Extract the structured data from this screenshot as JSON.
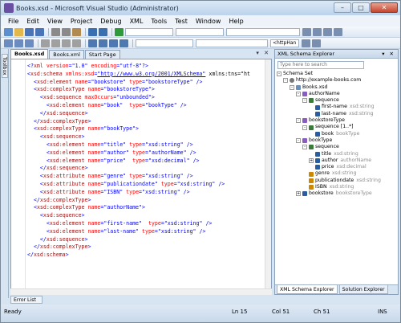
{
  "window": {
    "title": "Books.xsd - Microsoft Visual Studio (Administrator)",
    "buttons": [
      "–",
      "□",
      "✕"
    ]
  },
  "menu": [
    "File",
    "Edit",
    "View",
    "Project",
    "Debug",
    "XML",
    "Tools",
    "Test",
    "Window",
    "Help"
  ],
  "toolbar": {
    "combo_value": "<httpHan"
  },
  "left_tab": "Toolbox",
  "tabs": [
    "Books.xsd",
    "Books.xml",
    "Start Page"
  ],
  "editor": {
    "lines": [
      "<?xml version=\"1.0\" encoding=\"utf-8\"?>",
      "<xsd:schema xmlns:xsd=\"http://www.w3.org/2001/XMLSchema\" xmlns:tns=\"ht",
      "  <xsd:element name=\"bookstore\" type=\"bookstoreType\" />",
      "  <xsd:complexType name=\"bookstoreType\">",
      "    <xsd:sequence maxOccurs=\"unbounded\">",
      "      <xsd:element name=\"book\"  type=\"bookType\" />",
      "    </xsd:sequence>",
      "  </xsd:complexType>",
      "  <xsd:complexType name=\"bookType\">",
      "    <xsd:sequence>",
      "      <xsd:element name=\"title\" type=\"xsd:string\" />",
      "      <xsd:element name=\"author\" type=\"authorName\" />",
      "      <xsd:element name=\"price\"  type=\"xsd:decimal\" />",
      "    </xsd:sequence>",
      "    <xsd:attribute name=\"genre\" type=\"xsd:string\" />",
      "    <xsd:attribute name=\"publicationdate\" type=\"xsd:string\" />",
      "    <xsd:attribute name=\"ISBN\" type=\"xsd:string\" />",
      "  </xsd:complexType>",
      "  <xsd:complexType name=\"authorName\">",
      "    <xsd:sequence>",
      "      <xsd:element name=\"first-name\"  type=\"xsd:string\" />",
      "      <xsd:element name=\"last-name\" type=\"xsd:string\" />",
      "    </xsd:sequence>",
      "  </xsd:complexType>",
      "</xsd:schema>"
    ]
  },
  "explorer": {
    "title": "XML Schema Explorer",
    "pin_controls": "▾ ✕",
    "search_placeholder": "Type here to search",
    "tree": [
      {
        "label": "Schema Set",
        "type": "",
        "level": 0,
        "exp": "-",
        "icon": ""
      },
      {
        "label": "http://example-books.com",
        "type": "",
        "level": 1,
        "exp": "-",
        "icon": "ns"
      },
      {
        "label": "Books.xsd",
        "type": "",
        "level": 2,
        "exp": "-",
        "icon": "file"
      },
      {
        "label": "authorName",
        "type": "",
        "level": 3,
        "exp": "-",
        "icon": "type"
      },
      {
        "label": "sequence",
        "type": "",
        "level": 4,
        "exp": "-",
        "icon": "seq"
      },
      {
        "label": "first-name",
        "type": "xsd:string",
        "level": 5,
        "exp": "",
        "icon": "elem"
      },
      {
        "label": "last-name",
        "type": "xsd:string",
        "level": 5,
        "exp": "",
        "icon": "elem"
      },
      {
        "label": "bookstoreType",
        "type": "",
        "level": 3,
        "exp": "-",
        "icon": "type"
      },
      {
        "label": "sequence [1..*]",
        "type": "",
        "level": 4,
        "exp": "-",
        "icon": "seq"
      },
      {
        "label": "book",
        "type": "bookType",
        "level": 5,
        "exp": "",
        "icon": "elem"
      },
      {
        "label": "bookType",
        "type": "",
        "level": 3,
        "exp": "-",
        "icon": "type"
      },
      {
        "label": "sequence",
        "type": "",
        "level": 4,
        "exp": "-",
        "icon": "seq"
      },
      {
        "label": "title",
        "type": "xsd:string",
        "level": 5,
        "exp": "",
        "icon": "elem"
      },
      {
        "label": "author",
        "type": "authorName",
        "level": 5,
        "exp": "+",
        "icon": "elem"
      },
      {
        "label": "price",
        "type": "xsd:decimal",
        "level": 5,
        "exp": "",
        "icon": "elem"
      },
      {
        "label": "genre",
        "type": "xsd:string",
        "level": 4,
        "exp": "",
        "icon": "attr"
      },
      {
        "label": "publicationdate",
        "type": "xsd:string",
        "level": 4,
        "exp": "",
        "icon": "attr"
      },
      {
        "label": "ISBN",
        "type": "xsd:string",
        "level": 4,
        "exp": "",
        "icon": "attr"
      },
      {
        "label": "bookstore",
        "type": "bookstoreType",
        "level": 3,
        "exp": "+",
        "icon": "elem"
      }
    ],
    "tabs": [
      "XML Schema Explorer",
      "Solution Explorer"
    ]
  },
  "error_tab": "Error List",
  "status": {
    "ready": "Ready",
    "ln": "Ln 15",
    "col": "Col 51",
    "ch": "Ch 51",
    "ins": "INS"
  },
  "colors": {
    "keyword": "#0000ff",
    "tag": "#a31515",
    "attr": "#ff0000",
    "chrome": "#d7e4f2"
  }
}
